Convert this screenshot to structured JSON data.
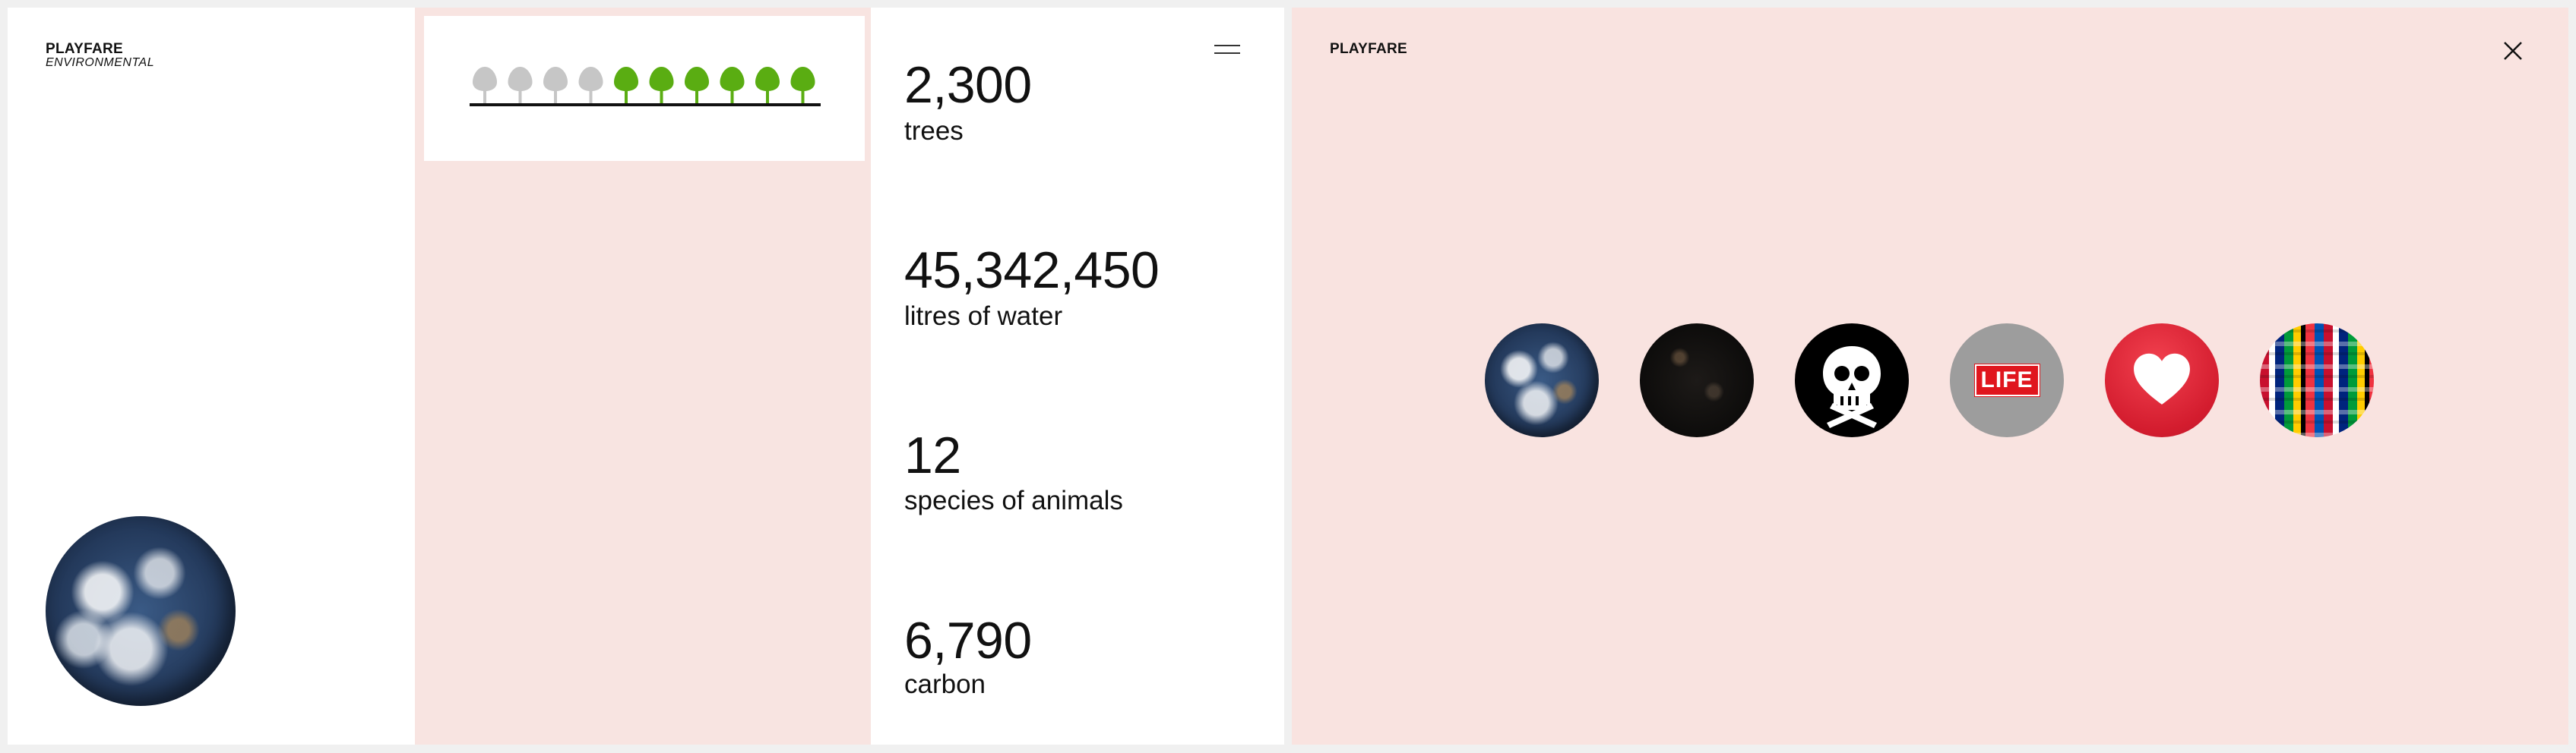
{
  "left_panel": {
    "brand_title": "PLAYFARE",
    "brand_subtitle": "ENVIRONMENTAL"
  },
  "trees_card": {
    "total_trees": 10,
    "grey_trees": 4,
    "green_trees": 6,
    "grey_color": "#c6c6c6",
    "green_color": "#5aad12",
    "ground_color": "#111111"
  },
  "stats": [
    {
      "value": "2,300",
      "label": "trees"
    },
    {
      "value": "45,342,450",
      "label": "litres of water"
    },
    {
      "value": "12",
      "label": "species of animals"
    },
    {
      "value": "6,790",
      "label": "carbon"
    }
  ],
  "overlay": {
    "brand": "PLAYFARE",
    "close_icon": "close-icon",
    "background": "#f9e3e0",
    "options": [
      {
        "name": "earth",
        "icon": "earth-icon"
      },
      {
        "name": "dark-planet",
        "icon": "dark-planet-icon"
      },
      {
        "name": "skull",
        "icon": "skull-crossbones-icon"
      },
      {
        "name": "life",
        "icon": "life-logo-icon",
        "text": "LIFE"
      },
      {
        "name": "heart",
        "icon": "heart-icon"
      },
      {
        "name": "flags",
        "icon": "world-flags-icon"
      }
    ]
  },
  "colors": {
    "panel_pink": "#f8e4e1",
    "life_red": "#e0161e",
    "heart_red": "#d31c2e"
  }
}
